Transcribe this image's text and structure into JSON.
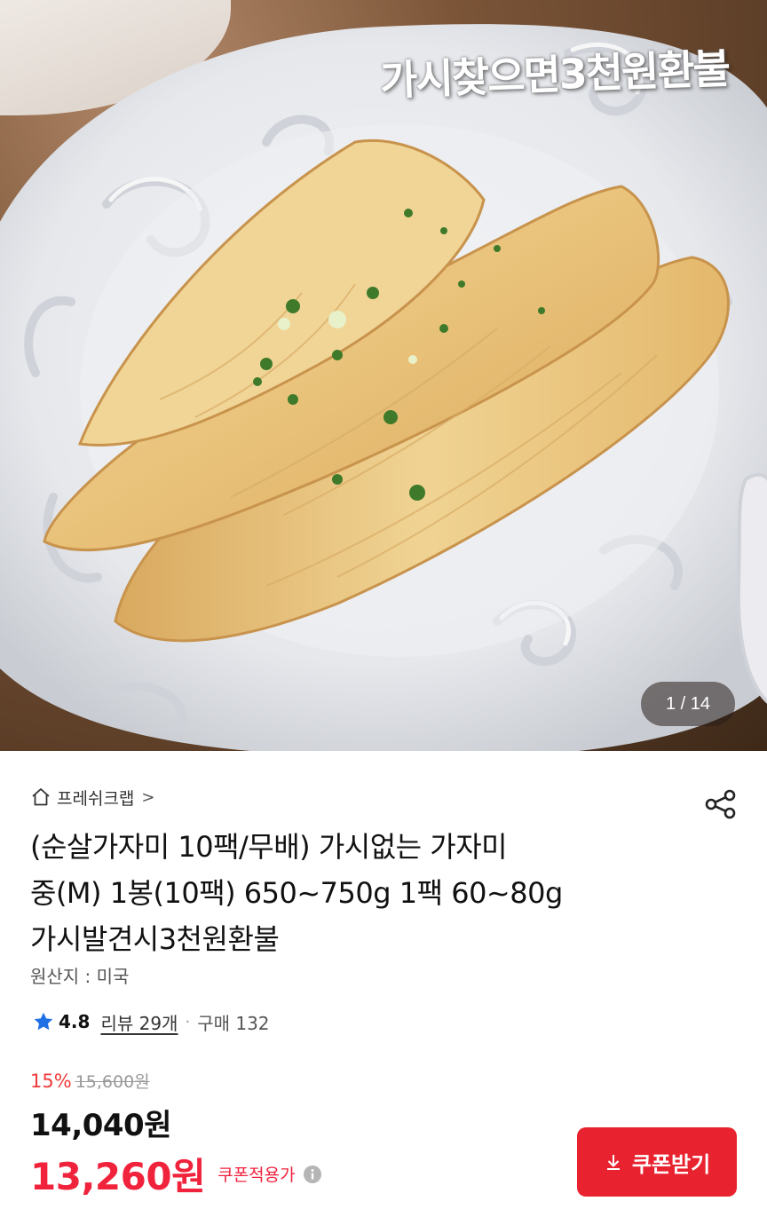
{
  "hero": {
    "overlay_text": "가시찾으면3천원환불",
    "counter": "1 / 14"
  },
  "store": {
    "name": "프레쉬크랩",
    "chevron": ">"
  },
  "product": {
    "title_lines": [
      "(순살가자미 10팩/무배) 가시없는 가자미",
      "중(M) 1봉(10팩) 650~750g 1팩 60~80g",
      "가시발견시3천원환불"
    ],
    "origin": "원산지 : 미국"
  },
  "rating": {
    "score": "4.8",
    "reviews": "리뷰 29개",
    "separator": "·",
    "purchases": "구매 132"
  },
  "pricing": {
    "discount_percent": "15%",
    "original_price": "15,600원",
    "price": "14,040원",
    "coupon_price": "13,260원",
    "coupon_label": "쿠폰적용가"
  },
  "coupon_button": {
    "label": "쿠폰받기"
  },
  "colors": {
    "accent_red": "#e8232f",
    "discount_red": "#f03a3a",
    "star_blue": "#1f6fe5"
  },
  "icons": {
    "home": "home-icon",
    "share": "share-icon",
    "star": "star-icon",
    "info": "info-icon",
    "download": "download-icon"
  }
}
